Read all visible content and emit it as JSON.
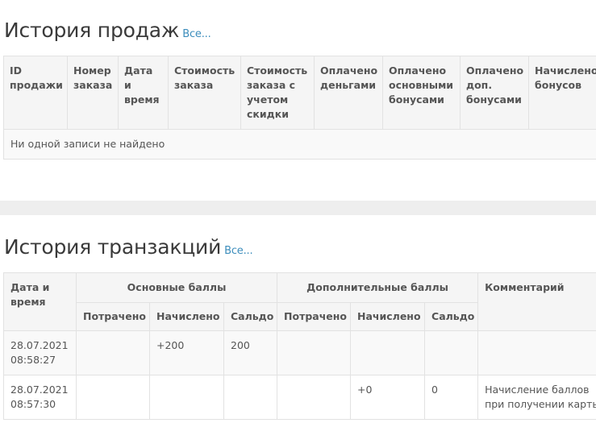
{
  "sales": {
    "title": "История продаж",
    "all_link": "Все...",
    "columns": [
      "ID продажи",
      "Номер заказа",
      "Дата и время",
      "Стоимость заказа",
      "Стоимость заказа с учетом скидки",
      "Оплачено деньгами",
      "Оплачено основными бонусами",
      "Оплачено доп. бонусами",
      "Начислено бонусов"
    ],
    "empty_message": "Ни одной записи не найдено"
  },
  "transactions": {
    "title": "История транзакций",
    "all_link": "Все...",
    "header": {
      "date_time": "Дата и время",
      "main_points": "Основные баллы",
      "extra_points": "Дополнительные баллы",
      "comment": "Комментарий",
      "spent": "Потрачено",
      "accrued": "Начислено",
      "balance": "Сальдо"
    },
    "rows": [
      {
        "date": "28.07.2021",
        "time": "08:58:27",
        "main_spent": "",
        "main_accrued": "+200",
        "main_balance": "200",
        "extra_spent": "",
        "extra_accrued": "",
        "extra_balance": "",
        "comment": ""
      },
      {
        "date": "28.07.2021",
        "time": "08:57:30",
        "main_spent": "",
        "main_accrued": "",
        "main_balance": "",
        "extra_spent": "",
        "extra_accrued": "+0",
        "extra_balance": "0",
        "comment": "Начисление баллов при получении карты"
      }
    ]
  }
}
